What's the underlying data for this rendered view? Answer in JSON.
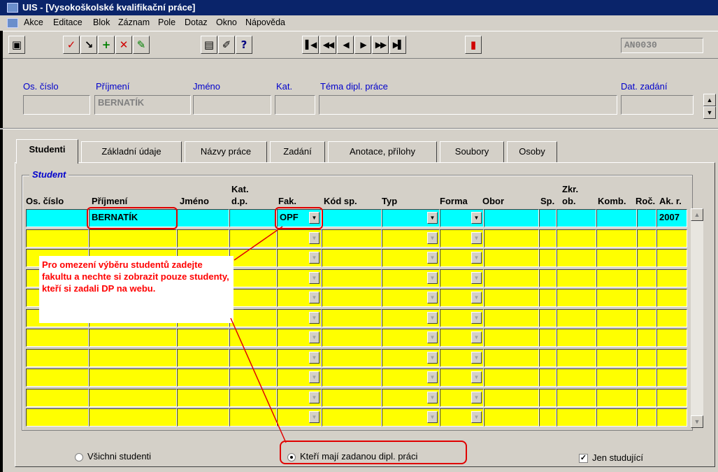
{
  "window": {
    "title": "UIS - [Vysokoškolské kvalifikační práce]"
  },
  "menu": [
    "Akce",
    "Editace",
    "Blok",
    "Záznam",
    "Pole",
    "Dotaz",
    "Okno",
    "Nápověda"
  ],
  "toolbar": {
    "module_code": "AN0030",
    "buttons": [
      {
        "name": "save-icon",
        "glyph": "▣"
      },
      {
        "name": "checkmark-icon",
        "glyph": "✓"
      },
      {
        "name": "cursor-icon",
        "glyph": "↘"
      },
      {
        "name": "add-record-icon",
        "glyph": "+"
      },
      {
        "name": "delete-record-icon",
        "glyph": "✕"
      },
      {
        "name": "edit-icon",
        "glyph": "✎"
      },
      {
        "name": "clipboard-icon",
        "glyph": "▤"
      },
      {
        "name": "pencil-icon",
        "glyph": "✐"
      },
      {
        "name": "help-icon",
        "glyph": "?"
      },
      {
        "name": "first-record-icon",
        "glyph": "▌◀"
      },
      {
        "name": "previous-page-icon",
        "glyph": "◀◀"
      },
      {
        "name": "previous-record-icon",
        "glyph": "◀"
      },
      {
        "name": "next-record-icon",
        "glyph": "▶"
      },
      {
        "name": "next-page-icon",
        "glyph": "▶▶"
      },
      {
        "name": "last-record-icon",
        "glyph": "▶▌"
      },
      {
        "name": "exit-icon",
        "glyph": "▮"
      }
    ]
  },
  "header": {
    "labels": {
      "os_cislo": "Os. číslo",
      "prijmeni": "Příjmení",
      "jmeno": "Jméno",
      "kat": "Kat.",
      "tema": "Téma dipl. práce",
      "dat_zadani": "Dat. zadání"
    },
    "values": {
      "os_cislo": "",
      "prijmeni": "BERNATÍK",
      "jmeno": "",
      "kat": "",
      "tema": "",
      "dat_zadani": ""
    }
  },
  "tabs": [
    "Studenti",
    "Základní údaje",
    "Názvy práce",
    "Zadání",
    "Anotace, přílohy",
    "Soubory",
    "Osoby"
  ],
  "active_tab": "Studenti",
  "group": {
    "title": "Student",
    "columns": {
      "os_cislo": "Os. číslo",
      "prijmeni": "Příjmení",
      "jmeno": "Jméno",
      "kat_top": "Kat.",
      "kat_bottom": "d.p.",
      "fak": "Fak.",
      "kod_sp": "Kód sp.",
      "typ": "Typ",
      "forma": "Forma",
      "obor": "Obor",
      "sp": "Sp.",
      "zkr_top": "Zkr.",
      "zkr_bottom": "ob.",
      "komb": "Komb.",
      "roc": "Roč.",
      "ak_r": "Ak. r."
    },
    "first_row": {
      "prijmeni": "BERNATÍK",
      "fak": "OPF",
      "ak_r": "2007"
    }
  },
  "callout": {
    "text": "Pro omezení výběru studentů zadejte fakultu a nechte si zobrazit pouze studenty, kteří si zadali DP na webu."
  },
  "filters": {
    "all_students": "Všichni studenti",
    "assigned_thesis": "Kteří mají zadanou dipl. práci",
    "only_studying": "Jen studující",
    "selected": "assigned_thesis",
    "only_studying_checked": true
  },
  "colors": {
    "row_selected": "#00ffff",
    "row_default": "#ffff00",
    "label_blue": "#0000cc",
    "annotation_red": "#ff0000"
  }
}
